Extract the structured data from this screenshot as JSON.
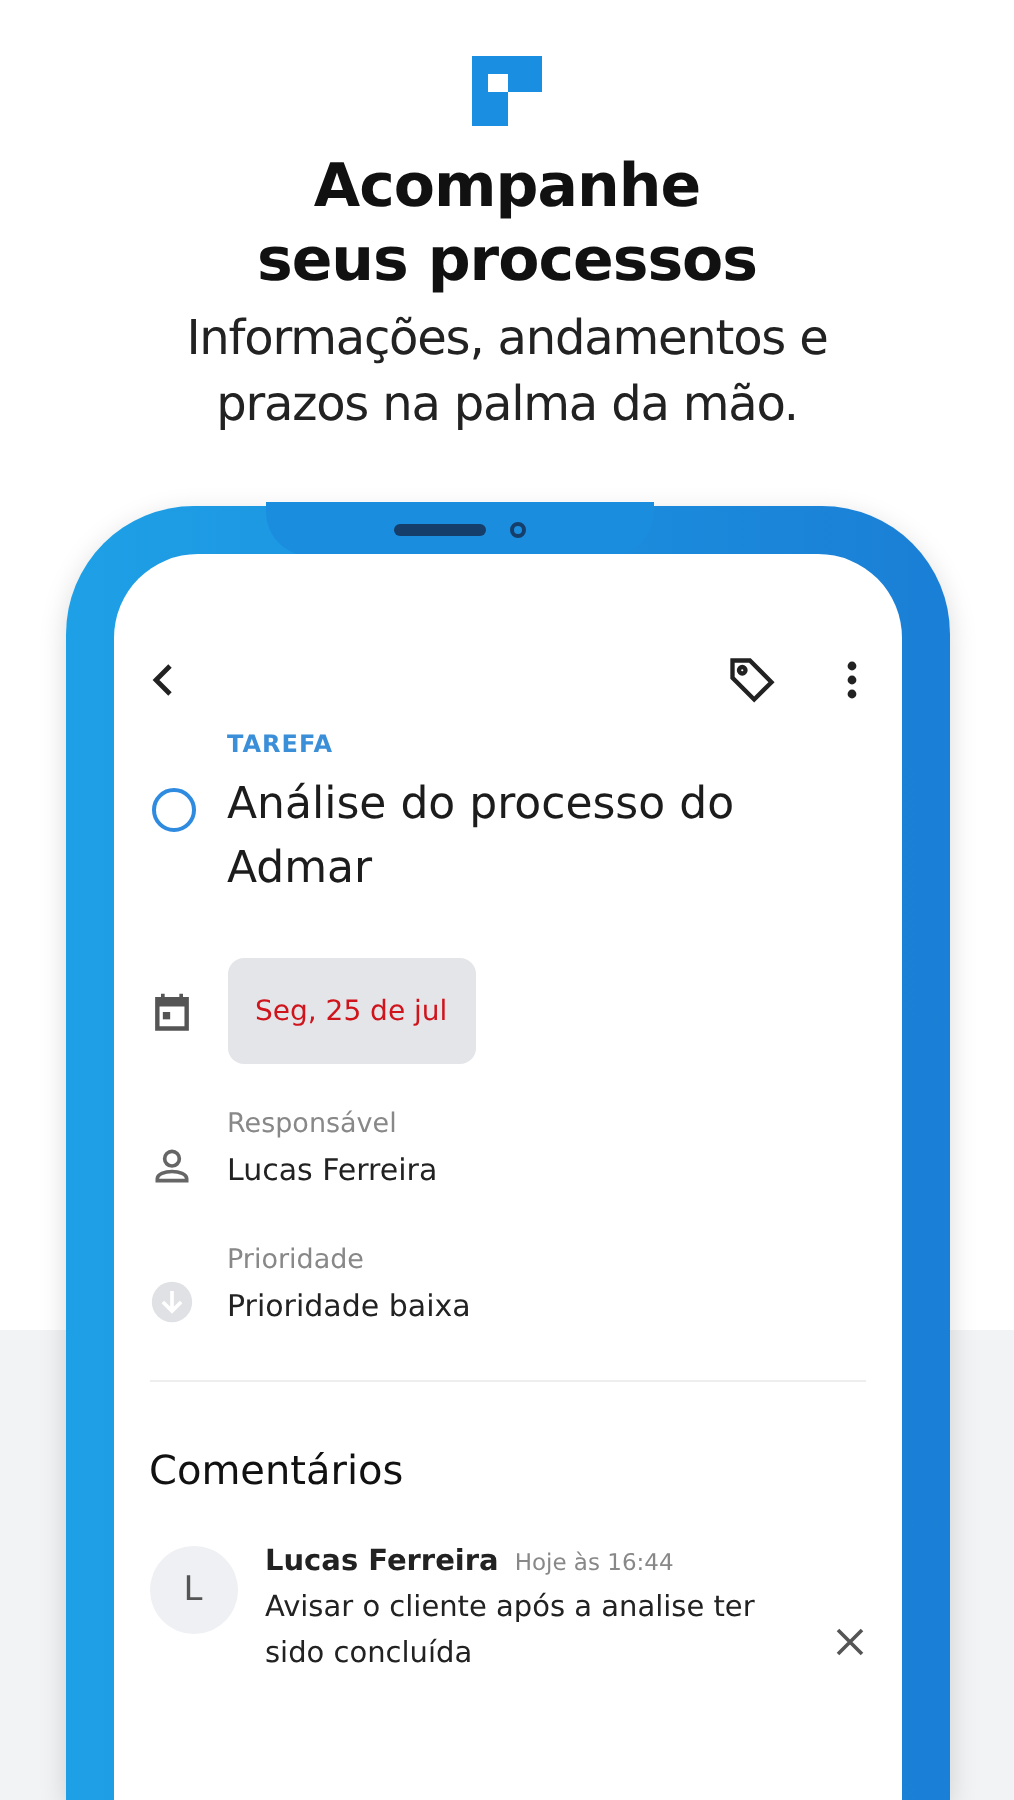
{
  "headline": {
    "title": "Acompanhe seus processos",
    "subtitle": "Informações, andamentos e prazos na palma da mão."
  },
  "task": {
    "category": "TAREFA",
    "title": "Análise do processo do Admar",
    "completed": false,
    "due_date": {
      "label": "Seg, 25 de jul",
      "overdue": true
    },
    "fields": [
      {
        "kind": "person",
        "label": "Responsável",
        "value": "Lucas Ferreira"
      },
      {
        "kind": "priority",
        "label": "Prioridade",
        "value": "Prioridade baixa"
      }
    ]
  },
  "comments": {
    "title": "Comentários",
    "items": [
      {
        "initial": "L",
        "author": "Lucas Ferreira",
        "time": "Hoje às 16:44",
        "text": "Avisar o cliente após a analise ter sido concluída"
      }
    ]
  }
}
